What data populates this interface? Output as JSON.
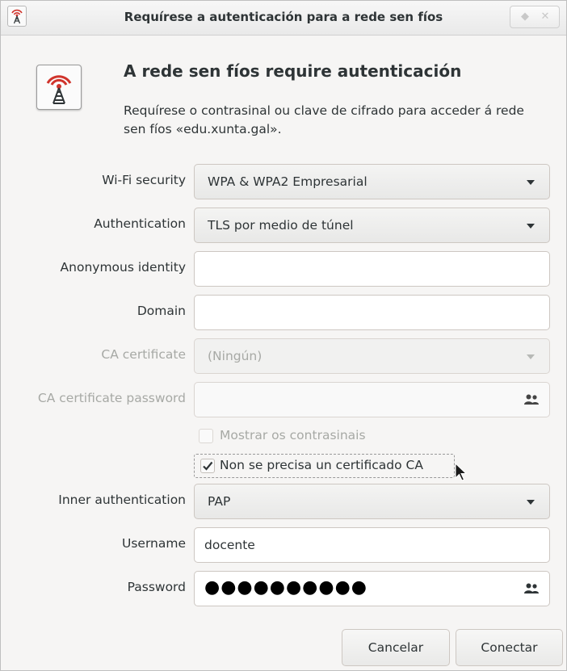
{
  "window": {
    "title": "Requírese a autenticación para a rede sen fíos",
    "app_icon": "wireless-network-icon",
    "controls": {
      "restore_icon": "restore-icon",
      "close_icon": "close-icon",
      "restore_glyph": "◆",
      "close_glyph": "✕"
    }
  },
  "header": {
    "icon": "wireless-antenna-icon",
    "title": "A rede sen fíos require autenticación",
    "description": "Requírese o contrasinal ou clave de cifrado para acceder á rede sen fíos «edu.xunta.gal»."
  },
  "form": {
    "wifi_security": {
      "label": "Wi-Fi security",
      "value": "WPA & WPA2 Empresarial"
    },
    "authentication": {
      "label": "Authentication",
      "value": "TLS por medio de túnel"
    },
    "anonymous_identity": {
      "label": "Anonymous identity",
      "value": ""
    },
    "domain": {
      "label": "Domain",
      "value": ""
    },
    "ca_certificate": {
      "label": "CA certificate",
      "value": "(Ningún)",
      "enabled": false
    },
    "ca_certificate_password": {
      "label": "CA certificate password",
      "value": "",
      "enabled": false
    },
    "show_passwords": {
      "label": "Mostrar os contrasinais",
      "checked": false,
      "enabled": false
    },
    "no_ca_required": {
      "label": "Non se precisa un certificado CA",
      "checked": true
    },
    "inner_authentication": {
      "label": "Inner authentication",
      "value": "PAP"
    },
    "username": {
      "label": "Username",
      "value": "docente"
    },
    "password": {
      "label": "Password",
      "value": "●●●●●●●●●●"
    }
  },
  "buttons": {
    "cancel": "Cancelar",
    "connect": "Conectar"
  },
  "colors": {
    "accent": "#d0342c",
    "text": "#2e3436",
    "disabled_text": "#a7a9a5",
    "background": "#f6f5f4"
  }
}
